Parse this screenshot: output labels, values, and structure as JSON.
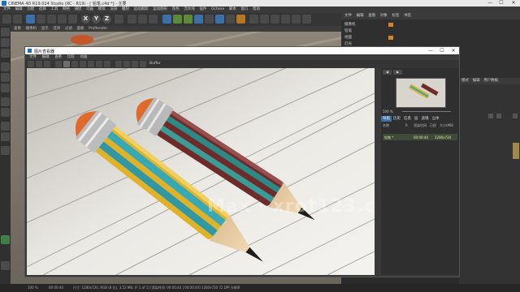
{
  "app": {
    "title": "CINEMA 4D R19.024 Studio (RC - R19) - [ 铅笔.c4d *] - 主要",
    "win_min": "—",
    "win_max": "☐",
    "win_close": "✕"
  },
  "menu": [
    "文件",
    "编辑",
    "创建",
    "选择",
    "工具",
    "网格",
    "捕捉",
    "动画",
    "模拟",
    "渲染",
    "雕刻",
    "运动跟踪",
    "运动图形",
    "角色",
    "流水线",
    "插件",
    "Octane",
    "脚本",
    "窗口",
    "帮助"
  ],
  "toolbar": {
    "xyz": [
      "X",
      "Y",
      "Z"
    ]
  },
  "viewport": {
    "menu": [
      "查看",
      "摄像机",
      "显示",
      "选项",
      "过滤",
      "面板",
      "ProRender"
    ]
  },
  "object_manager": {
    "tabs": [
      "文件",
      "编辑",
      "查看",
      "对象",
      "标签",
      "书签"
    ],
    "rows": [
      "摄像机",
      "铅笔",
      "地面",
      "灯光"
    ]
  },
  "attr_panel": {
    "tabs": [
      "模式",
      "编辑",
      "用户数据"
    ]
  },
  "picture_viewer": {
    "title": "图片查看器",
    "menu": [
      "文件",
      "编辑",
      "查看",
      "比较",
      "动画"
    ],
    "tools_label": "Buffer",
    "nav_prev": "◀",
    "nav_next": "▶",
    "zoom": "100 %",
    "tabs": [
      "导航",
      "历史",
      "信息",
      "层",
      "滤镜",
      "立体"
    ],
    "hist_head": [
      "名称",
      "R",
      "渲染时间",
      "已经",
      "大小(MB)"
    ],
    "hist_row": {
      "name": "铅笔 *",
      "time": "00:00:44",
      "extra": "1280x720"
    },
    "watermark": "Max · xrot123.cn"
  },
  "status": {
    "left": "100 %",
    "time": "00:00:44",
    "info": "尺寸: 1280x720, RGB (8 位), 3.52 MB, (F 1 of 1)  [渲染时间: 00:00:44 | 00:00:44]  1280x720 72 DPI  分辨率"
  }
}
